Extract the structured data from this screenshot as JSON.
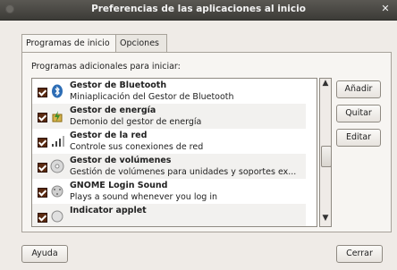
{
  "window": {
    "title": "Preferencias de las aplicaciones al inicio"
  },
  "tabs": [
    {
      "label": "Programas de inicio",
      "active": true
    },
    {
      "label": "Opciones",
      "active": false
    }
  ],
  "section": {
    "label": "Programas adicionales para iniciar:"
  },
  "list": {
    "items": [
      {
        "checked": true,
        "icon": "bluetooth-icon",
        "title": "Gestor de Bluetooth",
        "subtitle": "Miniaplicación del Gestor de Bluetooth"
      },
      {
        "checked": true,
        "icon": "energy-manager-icon",
        "title": "Gestor de energía",
        "subtitle": "Demonio del gestor de energía"
      },
      {
        "checked": true,
        "icon": "network-manager-icon",
        "title": "Gestor de la red",
        "subtitle": "Controle sus conexiones de red"
      },
      {
        "checked": true,
        "icon": "volume-manager-icon",
        "title": "Gestor de volúmenes",
        "subtitle": "Gestión de volúmenes para unidades y soportes ex..."
      },
      {
        "checked": true,
        "icon": "gnome-sound-icon",
        "title": "GNOME Login Sound",
        "subtitle": "Plays a sound whenever you log in"
      },
      {
        "checked": true,
        "icon": "indicator-applet-icon",
        "title": "Indicator applet",
        "subtitle": ""
      }
    ]
  },
  "buttons": {
    "add": "Añadir",
    "remove": "Quitar",
    "edit": "Editar"
  },
  "footer": {
    "help": "Ayuda",
    "close": "Cerrar"
  }
}
